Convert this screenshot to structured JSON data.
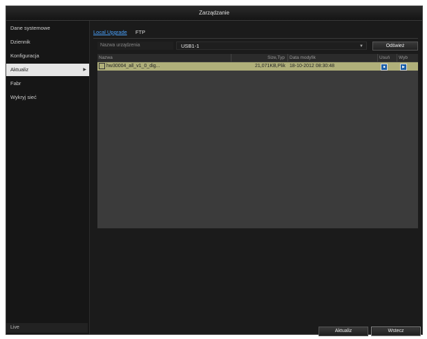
{
  "window": {
    "title": "Zarządzanie"
  },
  "sidebar": {
    "items": [
      {
        "label": "Dane systemowe"
      },
      {
        "label": "Dziennik"
      },
      {
        "label": "Konfiguracja"
      },
      {
        "label": "Aktualiz",
        "active": true
      },
      {
        "label": "Fabr"
      },
      {
        "label": "Wykryj sieć"
      }
    ],
    "live_label": "Live"
  },
  "tabs": [
    {
      "label": "Local Upgrade",
      "active": true
    },
    {
      "label": "FTP",
      "active": false
    }
  ],
  "device": {
    "label": "Nazwa urządzenia",
    "value": "USB1-1",
    "refresh_label": "Odśwież"
  },
  "table": {
    "columns": [
      "Nazwa",
      "Size,Typ",
      "Data modyfik",
      "Usuń",
      "Wyb"
    ],
    "rows": [
      {
        "name": "hw30004_all_v1_0_dig...",
        "size": "21,071KB,Plik",
        "date": "18-10-2012 08:30:48"
      }
    ]
  },
  "buttons": {
    "update": "Aktualiz",
    "exit": "Wstecz"
  },
  "colors": {
    "accent": "#4aa3ff",
    "row_highlight": "#b0b07a",
    "background": "#1b1b1b"
  }
}
